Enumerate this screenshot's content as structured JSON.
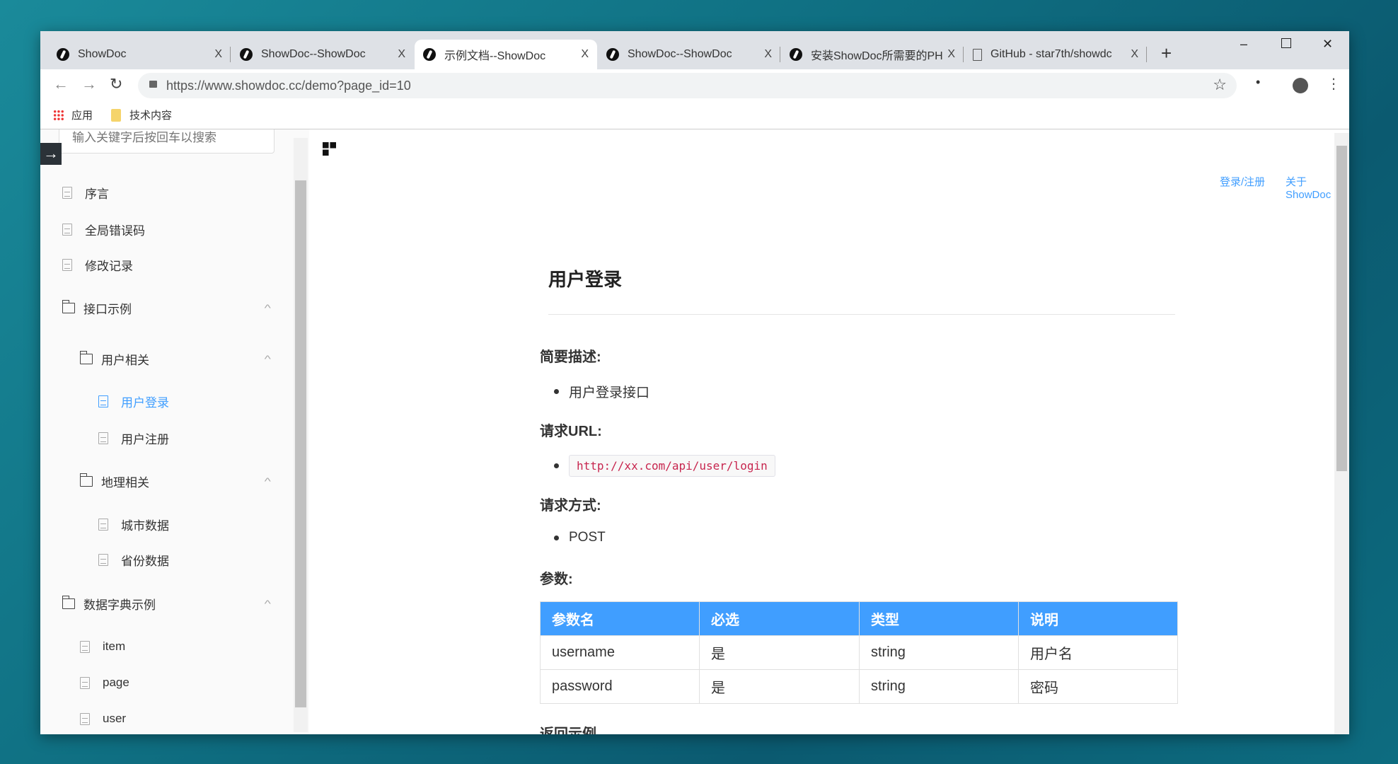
{
  "browser": {
    "tabs": [
      {
        "title": "ShowDoc",
        "icon": "showdoc-icon"
      },
      {
        "title": "ShowDoc--ShowDoc",
        "icon": "showdoc-icon"
      },
      {
        "title": "示例文档--ShowDoc",
        "icon": "showdoc-icon",
        "active": true
      },
      {
        "title": "ShowDoc--ShowDoc",
        "icon": "showdoc-icon"
      },
      {
        "title": "安装ShowDoc所需要的PH",
        "icon": "showdoc-icon"
      },
      {
        "title": "GitHub - star7th/showdc",
        "icon": "page-icon"
      }
    ],
    "close_glyph": "X",
    "new_tab": "+",
    "url": "https://www.showdoc.cc/demo?page_id=10",
    "bookmarks": [
      {
        "label": "应用",
        "icon": "apps-icon"
      },
      {
        "label": "技术内容",
        "icon": "folder-icon"
      }
    ]
  },
  "sidebar": {
    "search_placeholder": "输入关键字后按回车以搜索",
    "items": [
      {
        "label": "序言",
        "type": "doc"
      },
      {
        "label": "全局错误码",
        "type": "doc"
      },
      {
        "label": "修改记录",
        "type": "doc"
      },
      {
        "label": "接口示例",
        "type": "folder"
      },
      {
        "label": "用户相关",
        "type": "folder"
      },
      {
        "label": "用户登录",
        "type": "doc",
        "active": true
      },
      {
        "label": "用户注册",
        "type": "doc"
      },
      {
        "label": "地理相关",
        "type": "folder"
      },
      {
        "label": "城市数据",
        "type": "doc"
      },
      {
        "label": "省份数据",
        "type": "doc"
      },
      {
        "label": "数据字典示例",
        "type": "folder"
      },
      {
        "label": "item",
        "type": "doc"
      },
      {
        "label": "page",
        "type": "doc"
      },
      {
        "label": "user",
        "type": "doc"
      }
    ]
  },
  "header": {
    "login": "登录/注册",
    "about": "关于ShowDoc"
  },
  "doc": {
    "title": "用户登录",
    "desc_heading": "简要描述:",
    "desc": "用户登录接口",
    "url_heading": "请求URL:",
    "url": "http://xx.com/api/user/login",
    "method_heading": "请求方式:",
    "method": "POST",
    "params_heading": "参数:",
    "table": {
      "headers": [
        "参数名",
        "必选",
        "类型",
        "说明"
      ],
      "rows": [
        [
          "username",
          "是",
          "string",
          "用户名"
        ],
        [
          "password",
          "是",
          "string",
          "密码"
        ]
      ]
    },
    "return_heading": "返回示例"
  },
  "colors": {
    "accent": "#409eff",
    "code": "#c7254e"
  }
}
